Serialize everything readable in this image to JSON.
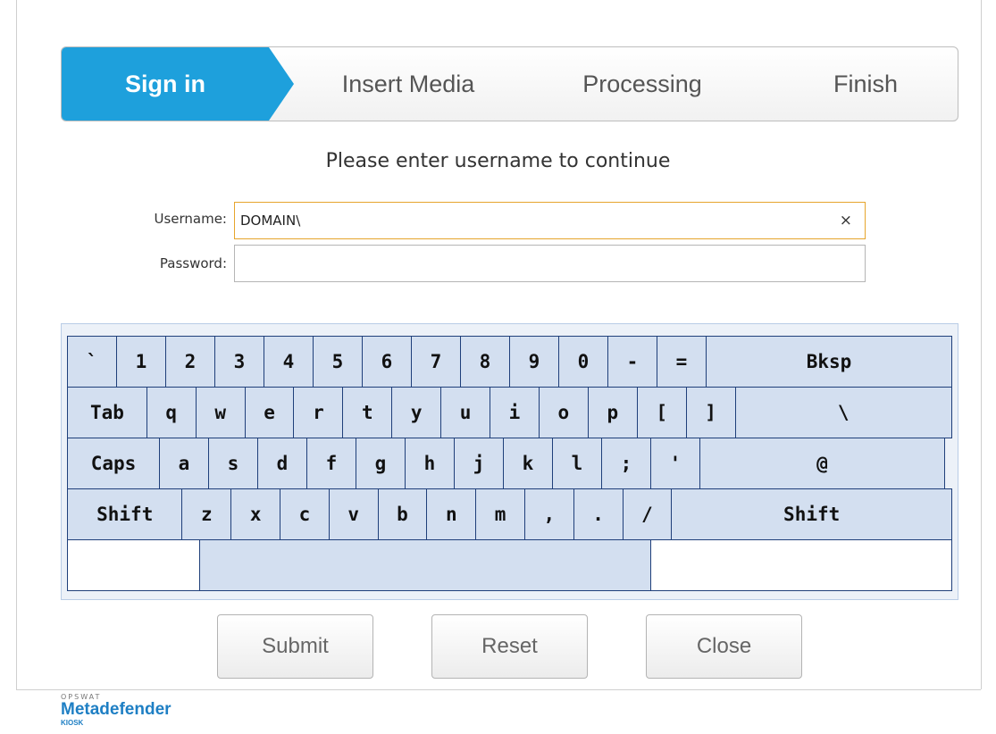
{
  "stepper": {
    "steps": [
      "Sign in",
      "Insert Media",
      "Processing",
      "Finish"
    ],
    "accent": "#1ea0dc"
  },
  "form": {
    "prompt": "Please enter username to continue",
    "username_label": "Username:",
    "username_value": "DOMAIN\\",
    "password_label": "Password:",
    "password_value": "",
    "clear_glyph": "×"
  },
  "keyboard": {
    "rows": [
      [
        "`",
        "1",
        "2",
        "3",
        "4",
        "5",
        "6",
        "7",
        "8",
        "9",
        "0",
        "-",
        "=",
        "Bksp"
      ],
      [
        "Tab",
        "q",
        "w",
        "e",
        "r",
        "t",
        "y",
        "u",
        "i",
        "o",
        "p",
        "[",
        "]",
        "\\"
      ],
      [
        "Caps",
        "a",
        "s",
        "d",
        "f",
        "g",
        "h",
        "j",
        "k",
        "l",
        ";",
        "'",
        "@"
      ],
      [
        "Shift",
        "z",
        "x",
        "c",
        "v",
        "b",
        "n",
        "m",
        ",",
        ".",
        "/",
        "Shift"
      ],
      [
        "",
        "",
        ""
      ]
    ],
    "key_color": "#d3dff0"
  },
  "actions": {
    "submit": "Submit",
    "reset": "Reset",
    "close": "Close"
  },
  "brand": {
    "company": "OPSWAT",
    "product": "Metadefender",
    "edition": "KIOSK"
  }
}
